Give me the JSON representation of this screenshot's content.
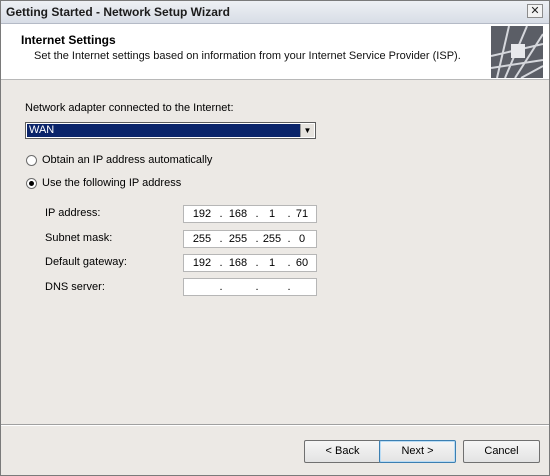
{
  "window": {
    "title": "Getting Started - Network Setup Wizard",
    "close_glyph": "✕"
  },
  "header": {
    "title": "Internet Settings",
    "subtitle": "Set the Internet settings based on information from your Internet Service Provider (ISP).",
    "graphic_icon": "wizard-banner-graphic"
  },
  "adapter": {
    "label": "Network adapter connected to the Internet:",
    "selected": "WAN",
    "arrow_glyph": "▼"
  },
  "ip_mode": {
    "auto_label": "Obtain an IP address automatically",
    "manual_label": "Use the following IP address",
    "selected": "manual"
  },
  "fields": [
    {
      "label": "IP address:",
      "octets": [
        "192",
        "168",
        "1",
        "71"
      ]
    },
    {
      "label": "Subnet mask:",
      "octets": [
        "255",
        "255",
        "255",
        "0"
      ]
    },
    {
      "label": "Default gateway:",
      "octets": [
        "192",
        "168",
        "1",
        "60"
      ]
    },
    {
      "label": "DNS server:",
      "octets": [
        "",
        "",
        "",
        ""
      ]
    }
  ],
  "buttons": {
    "back": "< Back",
    "next": "Next >",
    "cancel": "Cancel"
  }
}
